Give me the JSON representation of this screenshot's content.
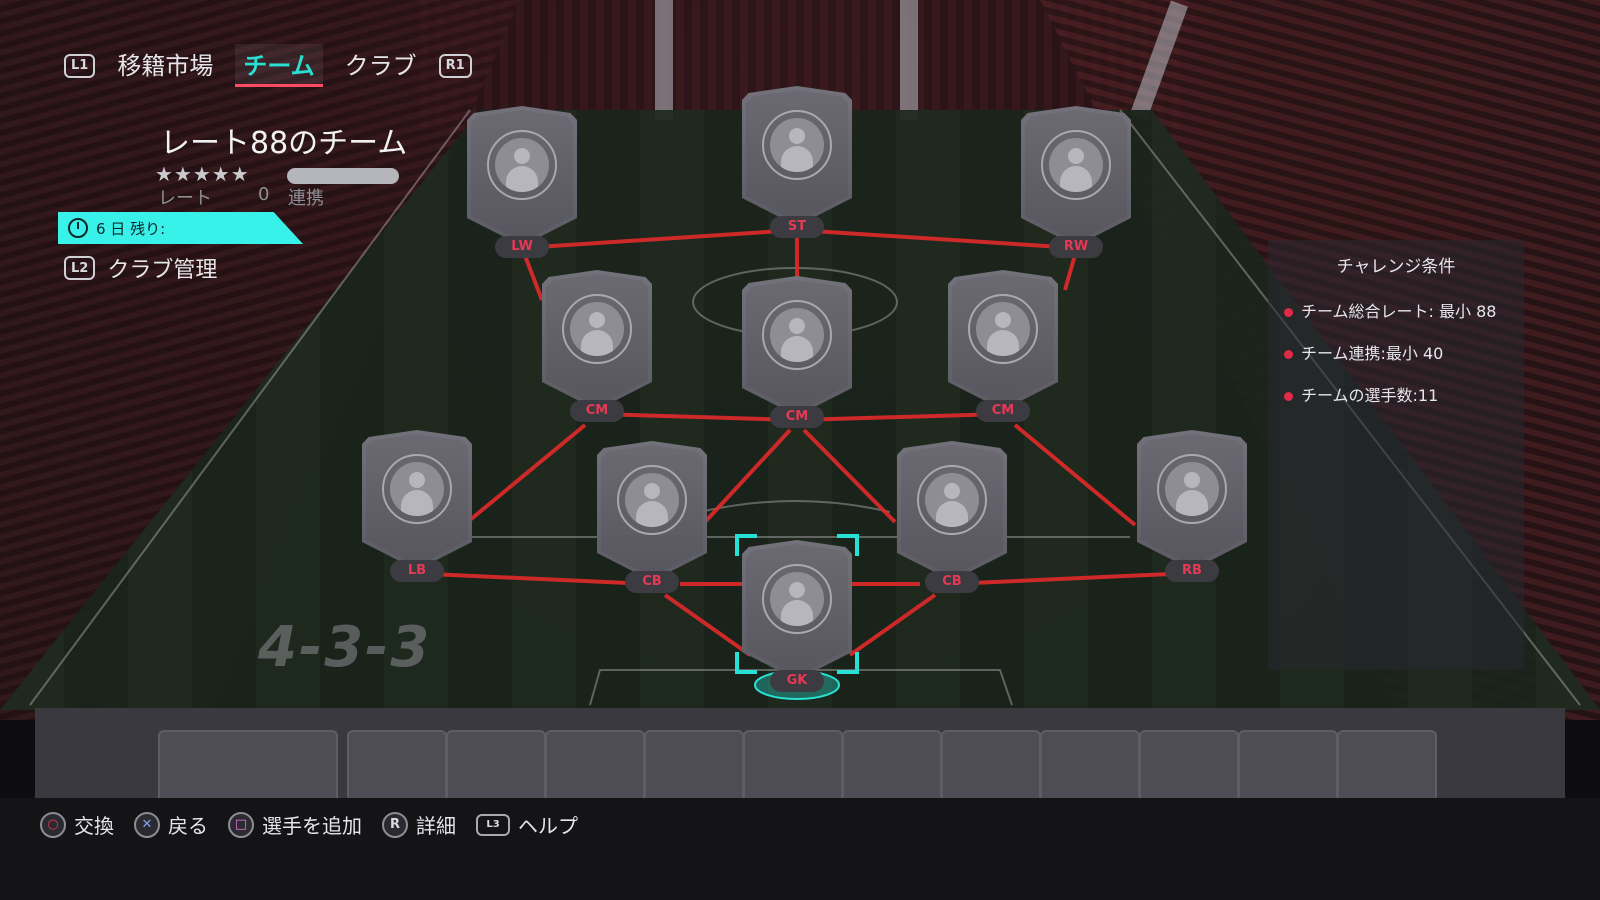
{
  "nav": {
    "left_button": "L1",
    "right_button": "R1",
    "tabs": [
      {
        "label": "移籍市場",
        "active": false
      },
      {
        "label": "チーム",
        "active": true
      },
      {
        "label": "クラブ",
        "active": false
      }
    ]
  },
  "squad": {
    "title": "レート88のチーム",
    "stars": "★★★★★",
    "rating_label": "レート",
    "rating_value": "0",
    "chemistry_label": "連携"
  },
  "timer": {
    "text": "6 日 残り:",
    "icon": "stopwatch-icon"
  },
  "club_management": {
    "button": "L2",
    "label": "クラブ管理"
  },
  "formation": "4-3-3",
  "positions": [
    "LW",
    "ST",
    "RW",
    "CM",
    "CM",
    "CM",
    "LB",
    "CB",
    "CB",
    "RB",
    "GK"
  ],
  "challenge": {
    "title": "チャレンジ条件",
    "requirements": [
      "チーム総合レート: 最小 88",
      "チーム連携:最小 40",
      "チームの選手数:11"
    ]
  },
  "hints": [
    {
      "button": "○",
      "label": "交換"
    },
    {
      "button": "✕",
      "label": "戻る"
    },
    {
      "button": "□",
      "label": "選手を追加"
    },
    {
      "button": "R",
      "label": "詳細"
    },
    {
      "button": "L3",
      "label": "ヘルプ"
    }
  ],
  "colors": {
    "accent": "#28e1d4",
    "timer_banner": "#38f2ea",
    "chemistry_link": "#e02a2a",
    "position_text": "#e53a55"
  }
}
